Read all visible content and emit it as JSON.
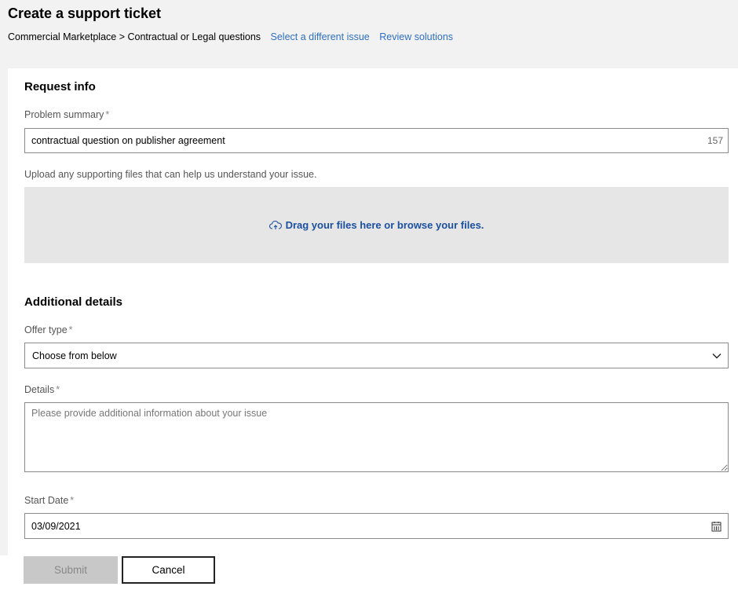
{
  "header": {
    "title": "Create a support ticket",
    "breadcrumb": "Commercial Marketplace > Contractual or Legal questions",
    "links": [
      "Select a different issue",
      "Review solutions"
    ]
  },
  "request_info": {
    "heading": "Request info",
    "summary_label": "Problem summary",
    "summary_value": "contractual question on publisher agreement",
    "summary_count": "157",
    "upload_label": "Upload any supporting files that can help us understand your issue.",
    "upload_text": "Drag your files here or browse your files."
  },
  "additional": {
    "heading": "Additional details",
    "offer_label": "Offer type",
    "offer_value": "Choose from below",
    "details_label": "Details",
    "details_placeholder": "Please provide additional information about your issue",
    "date_label": "Start Date",
    "date_value": "03/09/2021"
  },
  "required_marker": "*",
  "buttons": {
    "submit": "Submit",
    "cancel": "Cancel"
  },
  "colors": {
    "link": "#2f6fc4",
    "upload_text": "#1b4fa0",
    "disabled_button": "#c8c8c8"
  }
}
